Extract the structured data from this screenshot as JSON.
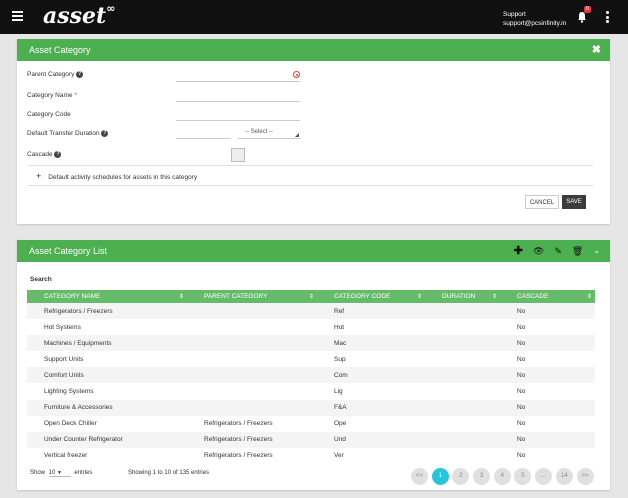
{
  "topbar": {
    "logo": "asset",
    "logo_mark": "∞",
    "support_title": "Support",
    "support_email": "support@pcsinfinity.in",
    "notification_count": "0"
  },
  "form_panel": {
    "title": "Asset Category",
    "fields": {
      "parent_category": "Parent Category",
      "category_name": "Category Name",
      "required_mark": "*",
      "category_code": "Category Code",
      "default_transfer_duration": "Default Transfer Duration",
      "duration_select": "-- Select --",
      "cascade": "Cascade"
    },
    "expander_plus": "+",
    "expander_label": "Default activity schedules for assets in this category",
    "cancel_label": "CANCEL",
    "save_label": "SAVE"
  },
  "list_panel": {
    "title": "Asset Category List",
    "search_label": "Search",
    "columns": [
      "CATEGORY NAME",
      "PARENT CATEGORY",
      "CATEGORY CODE",
      "DURATION",
      "CASCADE"
    ],
    "rows": [
      [
        "Refrigerators / Freezers",
        "",
        "Ref",
        "",
        "No"
      ],
      [
        "Hot Systems",
        "",
        "Hot",
        "",
        "No"
      ],
      [
        "Machines / Equipments",
        "",
        "Mac",
        "",
        "No"
      ],
      [
        "Support Units",
        "",
        "Sup",
        "",
        "No"
      ],
      [
        "Comfort Units",
        "",
        "Com",
        "",
        "No"
      ],
      [
        "Lighting Systems",
        "",
        "Lig",
        "",
        "No"
      ],
      [
        "Furniture & Accessories",
        "",
        "F&A",
        "",
        "No"
      ],
      [
        "Open Deck Chiller",
        "Refrigerators / Freezers",
        "Ope",
        "",
        "No"
      ],
      [
        "Under Counter Refrigerator",
        "Refrigerators / Freezers",
        "Und",
        "",
        "No"
      ],
      [
        "Vertical freezer",
        "Refrigerators / Freezers",
        "Ver",
        "",
        "No"
      ]
    ],
    "show_label": "Show",
    "page_size": "10",
    "entries_label": "entries",
    "showing_text": "Showing 1 to 10 of 135 entries",
    "pagination": [
      "<<",
      "1",
      "2",
      "3",
      "4",
      "5",
      "...",
      "14",
      ">>"
    ],
    "active_page": "1"
  },
  "colors": {
    "header_green": "#4caf50",
    "table_header_green": "#66bb6a",
    "active_page": "#26c6da",
    "topbar": "#111111"
  }
}
